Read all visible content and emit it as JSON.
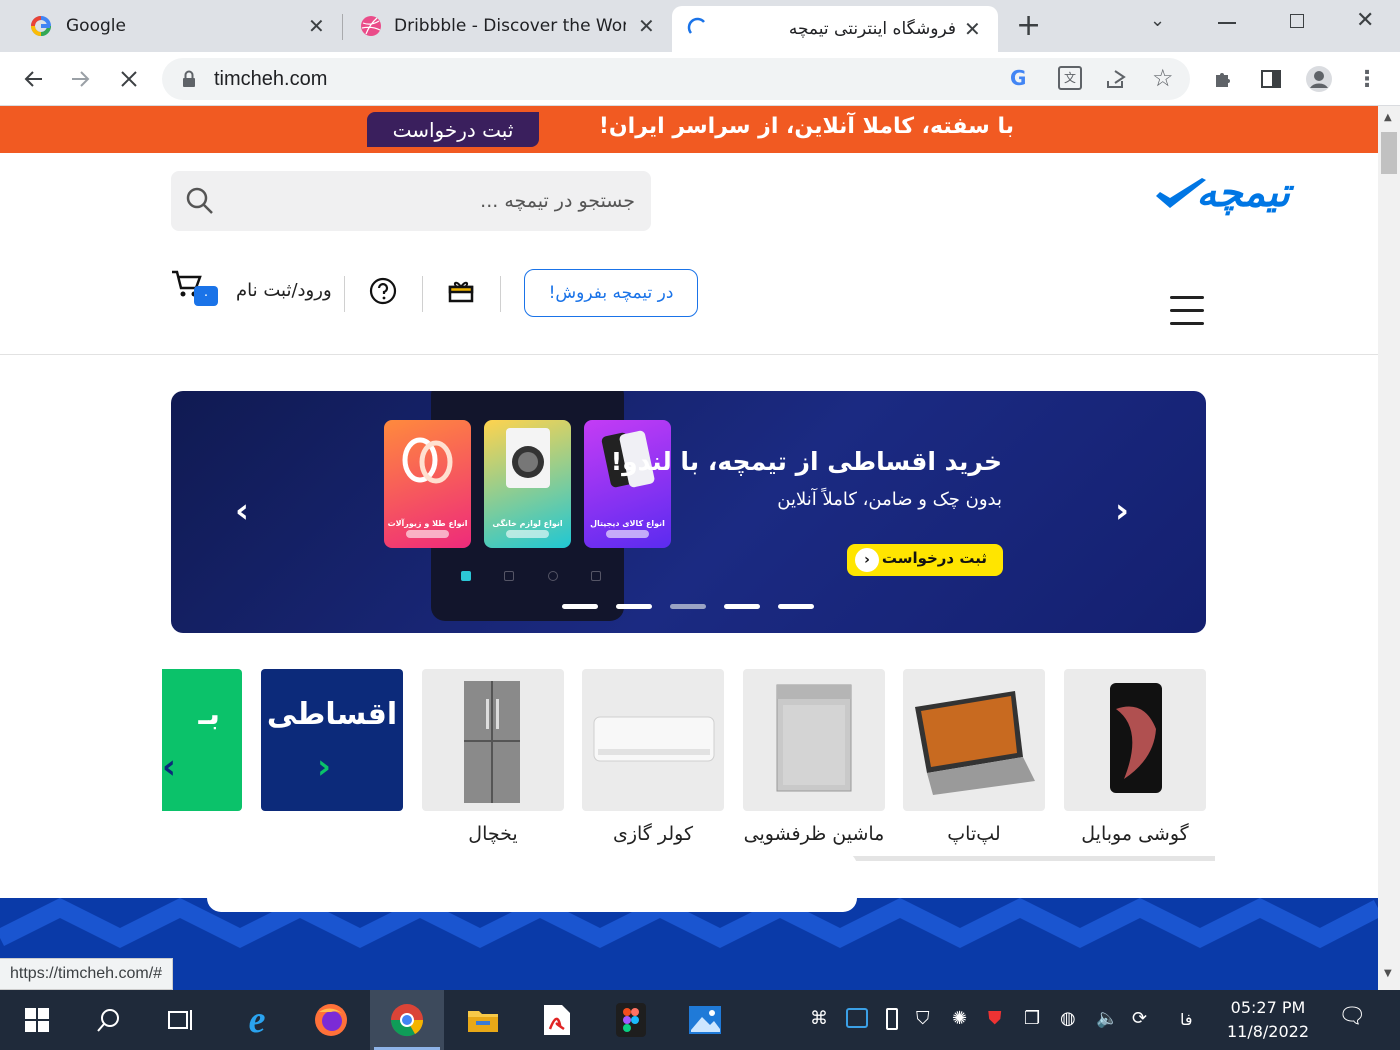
{
  "browser": {
    "tabs": [
      {
        "title": "Google",
        "icon": "google-favicon"
      },
      {
        "title": "Dribbble - Discover the World",
        "icon": "dribbble-favicon"
      },
      {
        "title": "فروشگاه اینترنتی تیمچه",
        "icon": "loading-spinner",
        "active": true
      }
    ],
    "new_tab": "+",
    "url": "timcheh.com",
    "status_url": "https://timcheh.com/#"
  },
  "site": {
    "promo_text": "با سفته، کاملا آنلاین، از سراسر ایران!",
    "promo_button": "ثبت درخواست",
    "logo_text": "تیمچه",
    "search_placeholder": "جستجو در تیمچه ...",
    "sell_button": "در تیمچه بفروش!",
    "login": "ورود/ثبت نام",
    "cart_count": "۰"
  },
  "banner": {
    "title": "خرید اقساطی از تیمچه، با لندو!",
    "subtitle": "بدون چک و ضامن، کاملاً آنلاین",
    "cta": "ثبت درخواست",
    "cards": [
      {
        "caption": "انواع طلا و زیورآلات",
        "color": "#f5356d"
      },
      {
        "caption": "انواع لوازم خانگی",
        "color": "#1fc7d4"
      },
      {
        "caption": "انواع کالای دیجیتال",
        "color": "#8a2bf0"
      }
    ],
    "slides": 5,
    "active_slide": 2
  },
  "categories": [
    {
      "label": "گوشی موبایل",
      "icon": "mobile-phone"
    },
    {
      "label": "لپ‌تاپ",
      "icon": "laptop"
    },
    {
      "label": "ماشین ظرفشویی",
      "icon": "dishwasher"
    },
    {
      "label": "کولر گازی",
      "icon": "air-conditioner"
    },
    {
      "label": "یخچال",
      "icon": "refrigerator"
    }
  ],
  "promo_tiles": [
    {
      "text": "اقساطی",
      "color": "#0c2a7a"
    },
    {
      "text": "بـ",
      "color": "#0bc26a"
    }
  ],
  "taskbar": {
    "time": "05:27 PM",
    "date": "11/8/2022",
    "lang": "فا"
  }
}
